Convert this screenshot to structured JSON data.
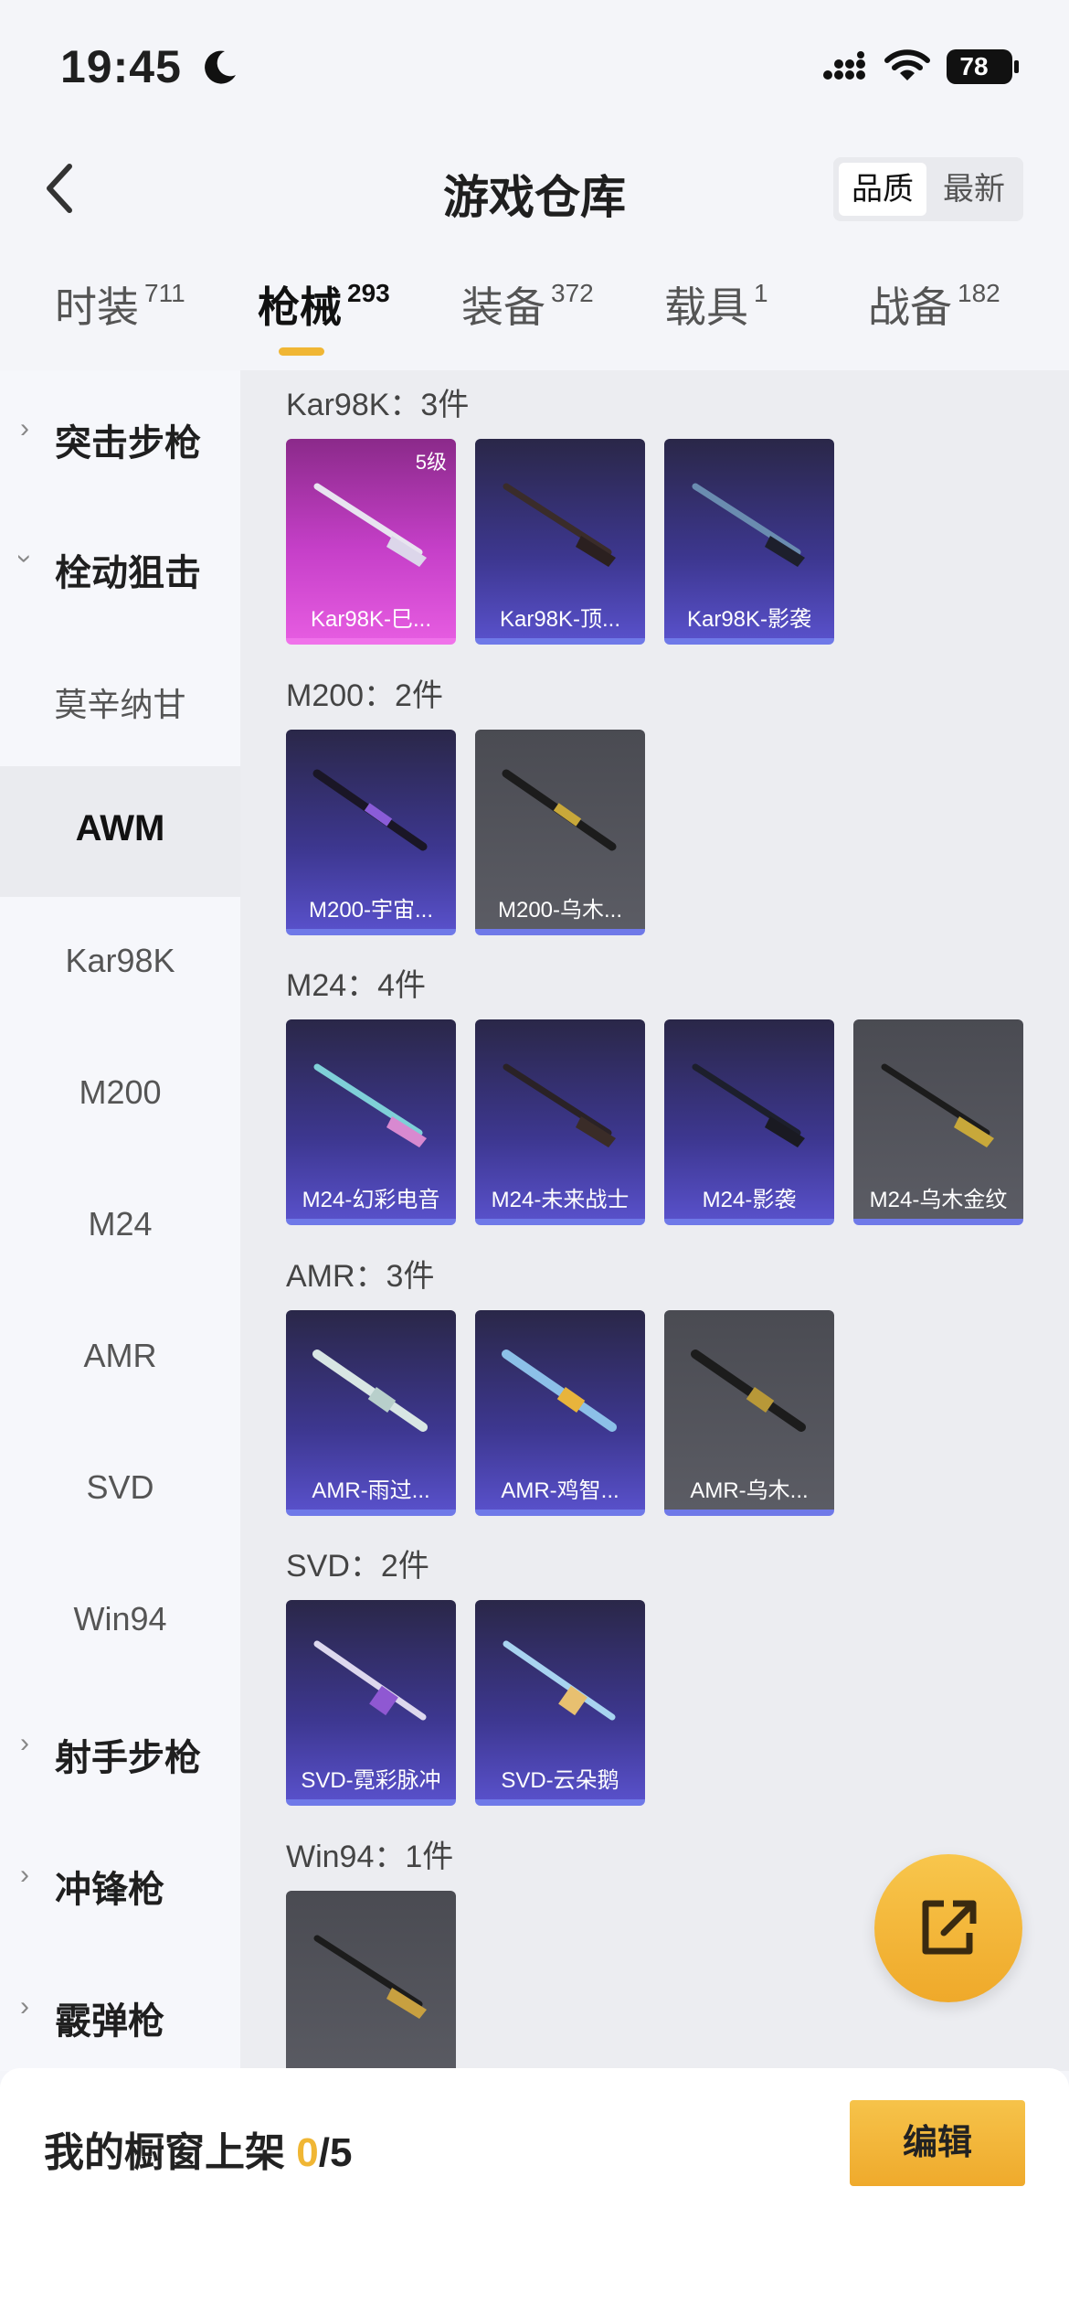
{
  "status_bar": {
    "time": "19:45",
    "battery": "78"
  },
  "header": {
    "title": "游戏仓库",
    "sort_options": [
      "品质",
      "最新"
    ]
  },
  "tabs": [
    {
      "label": "时装",
      "count": "711"
    },
    {
      "label": "枪械",
      "count": "293"
    },
    {
      "label": "装备",
      "count": "372"
    },
    {
      "label": "载具",
      "count": "1"
    },
    {
      "label": "战备",
      "count": "182"
    }
  ],
  "sidebar": {
    "items": [
      {
        "label": "突击步枪",
        "type": "category",
        "expanded": false
      },
      {
        "label": "栓动狙击",
        "type": "category",
        "expanded": true
      },
      {
        "label": "莫辛纳甘",
        "type": "sub"
      },
      {
        "label": "AWM",
        "type": "sub",
        "selected": true
      },
      {
        "label": "Kar98K",
        "type": "sub"
      },
      {
        "label": "M200",
        "type": "sub"
      },
      {
        "label": "M24",
        "type": "sub"
      },
      {
        "label": "AMR",
        "type": "sub"
      },
      {
        "label": "SVD",
        "type": "sub"
      },
      {
        "label": "Win94",
        "type": "sub"
      },
      {
        "label": "射手步枪",
        "type": "category",
        "expanded": false
      },
      {
        "label": "冲锋枪",
        "type": "category",
        "expanded": false
      },
      {
        "label": "霰弹枪",
        "type": "category",
        "expanded": false
      }
    ]
  },
  "groups": [
    {
      "title": "Kar98K：3件",
      "items": [
        {
          "label": "Kar98K-巳...",
          "rarity": "pink",
          "level": "5级"
        },
        {
          "label": "Kar98K-顶...",
          "rarity": "purple"
        },
        {
          "label": "Kar98K-影袭",
          "rarity": "purple"
        }
      ]
    },
    {
      "title": "M200：2件",
      "items": [
        {
          "label": "M200-宇宙...",
          "rarity": "purple"
        },
        {
          "label": "M200-乌木...",
          "rarity": "gray"
        }
      ]
    },
    {
      "title": "M24：4件",
      "items": [
        {
          "label": "M24-幻彩电音",
          "rarity": "purple"
        },
        {
          "label": "M24-未来战士",
          "rarity": "purple"
        },
        {
          "label": "M24-影袭",
          "rarity": "purple"
        },
        {
          "label": "M24-乌木金纹",
          "rarity": "gray"
        }
      ]
    },
    {
      "title": "AMR：3件",
      "items": [
        {
          "label": "AMR-雨过...",
          "rarity": "purple"
        },
        {
          "label": "AMR-鸡智...",
          "rarity": "purple"
        },
        {
          "label": "AMR-乌木...",
          "rarity": "gray"
        }
      ]
    },
    {
      "title": "SVD：2件",
      "items": [
        {
          "label": "SVD-霓彩脉冲",
          "rarity": "purple"
        },
        {
          "label": "SVD-云朵鹅",
          "rarity": "purple"
        }
      ]
    },
    {
      "title": "Win94：1件",
      "items": [
        {
          "label": "",
          "rarity": "gray"
        }
      ]
    }
  ],
  "showcase": {
    "label": "我的橱窗上架 ",
    "current": "0",
    "total": "/5"
  },
  "edit_button": "编辑",
  "colors": {
    "accent": "#f0b634",
    "purple_card": "#3d3790",
    "pink_card": "#c53fc8",
    "gray_card": "#55565d"
  }
}
